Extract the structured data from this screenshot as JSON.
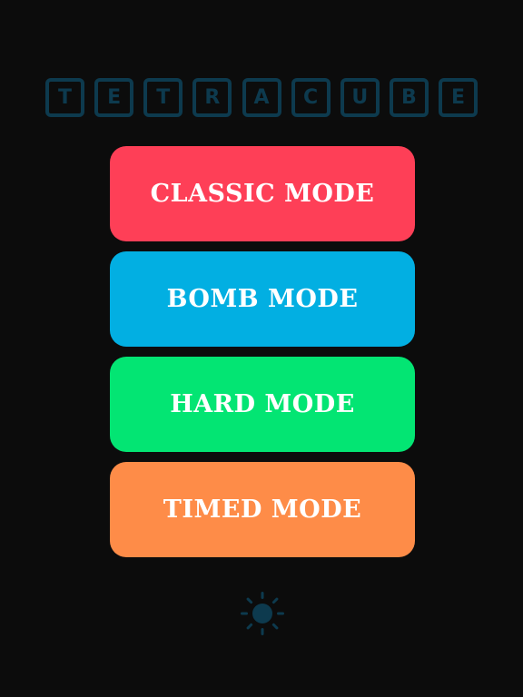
{
  "title": {
    "letters": [
      "T",
      "E",
      "T",
      "R",
      "A",
      "C",
      "U",
      "B",
      "E"
    ],
    "color": "#0d3a4e"
  },
  "menu": {
    "buttons": [
      {
        "label": "CLASSIC MODE",
        "color": "#fe3f57"
      },
      {
        "label": "BOMB MODE",
        "color": "#02afe2"
      },
      {
        "label": "HARD MODE",
        "color": "#03e573"
      },
      {
        "label": "TIMED MODE",
        "color": "#fe8c48"
      }
    ]
  },
  "settings": {
    "icon": "sun-icon",
    "color": "#0d3a4e"
  }
}
